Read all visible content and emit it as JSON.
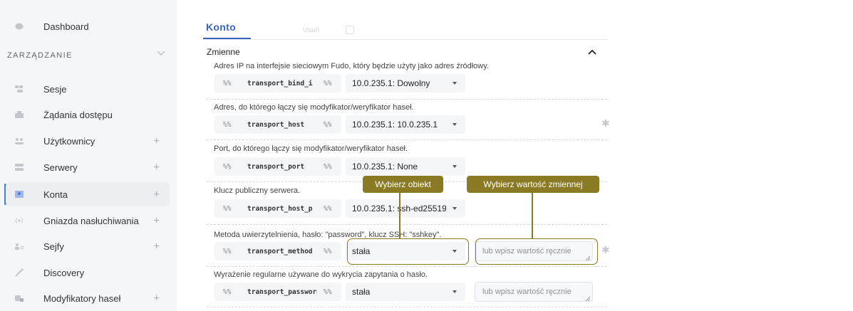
{
  "sidebar": {
    "top_item": {
      "label": "Dashboard",
      "icon": "dashboard-icon"
    },
    "section_title": "ZARZĄDZANIE",
    "items": [
      {
        "label": "Sesje",
        "icon": "sessions-icon",
        "has_plus": false,
        "active": false
      },
      {
        "label": "Żądania dostępu",
        "icon": "access-requests-icon",
        "has_plus": false,
        "active": false
      },
      {
        "label": "Użytkownicy",
        "icon": "users-icon",
        "has_plus": true,
        "active": false
      },
      {
        "label": "Serwery",
        "icon": "servers-icon",
        "has_plus": true,
        "active": false
      },
      {
        "label": "Konta",
        "icon": "accounts-icon",
        "has_plus": true,
        "active": true
      },
      {
        "label": "Gniazda nasłuchiwania",
        "icon": "listeners-icon",
        "has_plus": true,
        "active": false
      },
      {
        "label": "Sejfy",
        "icon": "safes-icon",
        "has_plus": true,
        "active": false
      },
      {
        "label": "Discovery",
        "icon": "discovery-icon",
        "has_plus": false,
        "active": false
      },
      {
        "label": "Modyfikatory haseł",
        "icon": "password-modifiers-icon",
        "has_plus": true,
        "active": false
      }
    ],
    "plus_symbol": "+"
  },
  "tabs": {
    "active": "Konto",
    "secondary": "Usuń"
  },
  "section": {
    "title": "Zmienne"
  },
  "variables": [
    {
      "description": "Adres IP na interfejsie sieciowym Fudo, który będzie użyty jako adres źródłowy.",
      "prefix": "%%",
      "name": "transport_bind_i",
      "suffix": "%%",
      "select_value": "10.0.235.1: Dowolny",
      "has_textarea": false
    },
    {
      "description": "Adres, do którego łączy się modyfikator/weryfikator haseł.",
      "prefix": "%%",
      "name": "transport_host",
      "suffix": "%%",
      "select_value": "10.0.235.1: 10.0.235.1",
      "has_textarea": false
    },
    {
      "description": "Port, do którego łączy się modyfikator/weryfikator haseł.",
      "prefix": "%%",
      "name": "transport_port",
      "suffix": "%%",
      "select_value": "10.0.235.1: None",
      "has_textarea": false
    },
    {
      "description": "Klucz publiczny serwera.",
      "prefix": "%%",
      "name": "transport_host_p",
      "suffix": "%%",
      "select_value": "10.0.235.1: ssh-ed25519",
      "has_textarea": false
    },
    {
      "description": "Metoda uwierzytelnienia, hasło: \"password\", klucz SSH: \"sshkey\".",
      "prefix": "%%",
      "name": "transport_method",
      "suffix": "%%",
      "select_value": "stała",
      "has_textarea": true,
      "textarea_placeholder": "lub wpisz wartość ręcznie"
    },
    {
      "description": "Wyrażenie regularne używane do wykrycia zapytania o hasło.",
      "prefix": "%%",
      "name": "transport_password",
      "suffix": "%%",
      "select_value": "stała",
      "has_textarea": true,
      "textarea_placeholder": "lub wpisz wartość ręcznie"
    }
  ],
  "callouts": {
    "object": "Wybierz obiekt",
    "value": "Wybierz wartość zmiennej"
  },
  "colors": {
    "accent": "#3566c5",
    "callout": "#8a7a23",
    "sidebar_bg": "#f5f6f8"
  }
}
